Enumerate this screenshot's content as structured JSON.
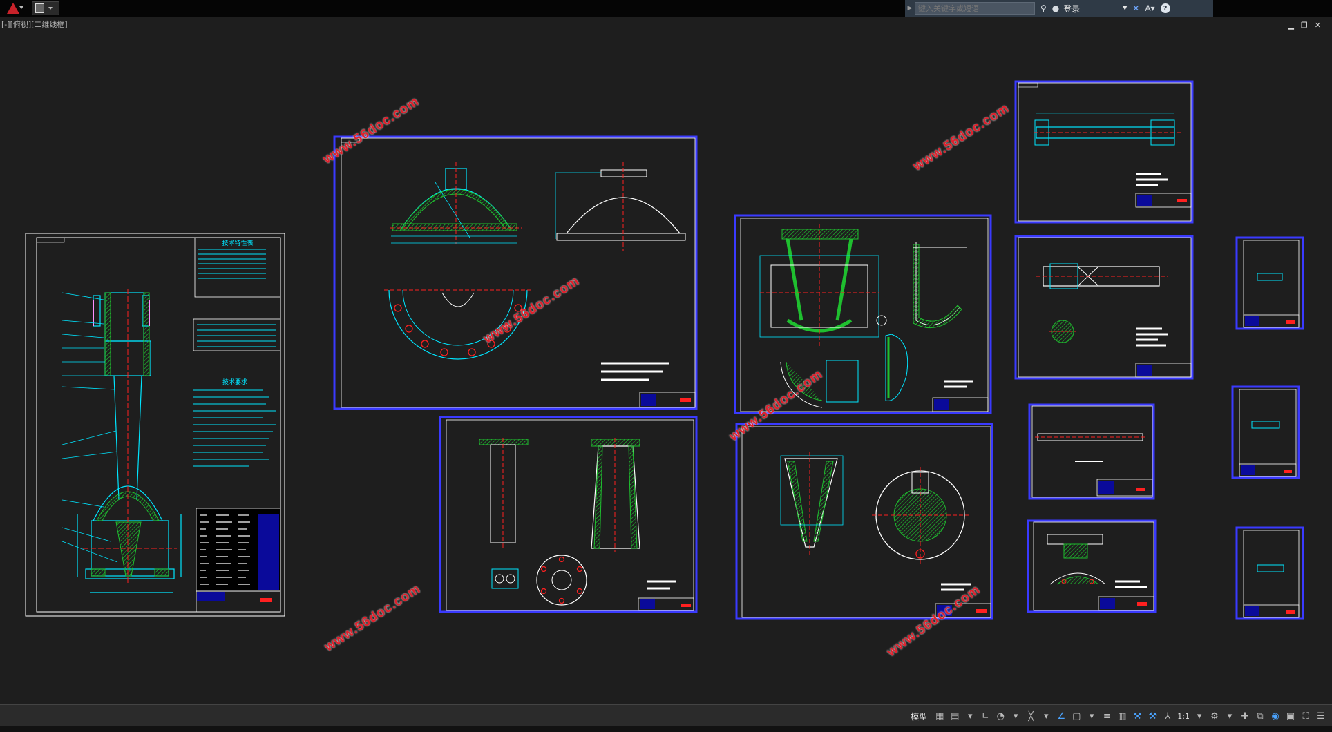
{
  "titlebar": {
    "search_placeholder": "键入关键字或短语",
    "login_label": "登录",
    "help_label": "?"
  },
  "viewport_label": "[-][俯视][二维线框]",
  "sheets": {
    "main": {
      "table_title": "技术特性表",
      "notes_title": "技术要求"
    }
  },
  "watermarks": [
    "www.56doc.com",
    "www.56doc.com",
    "www.56doc.com",
    "www.56doc.com",
    "www.56doc.com",
    "www.56doc.com"
  ],
  "statusbar": {
    "model_label": "模型",
    "scale_label": "1:1"
  },
  "colors": {
    "canvas": "#1e1e1e",
    "frame": "#3a3aff",
    "cyan": "#00e5ff",
    "green": "#1fbf2f",
    "red": "#ff2020",
    "watermark": "#e0202c"
  }
}
